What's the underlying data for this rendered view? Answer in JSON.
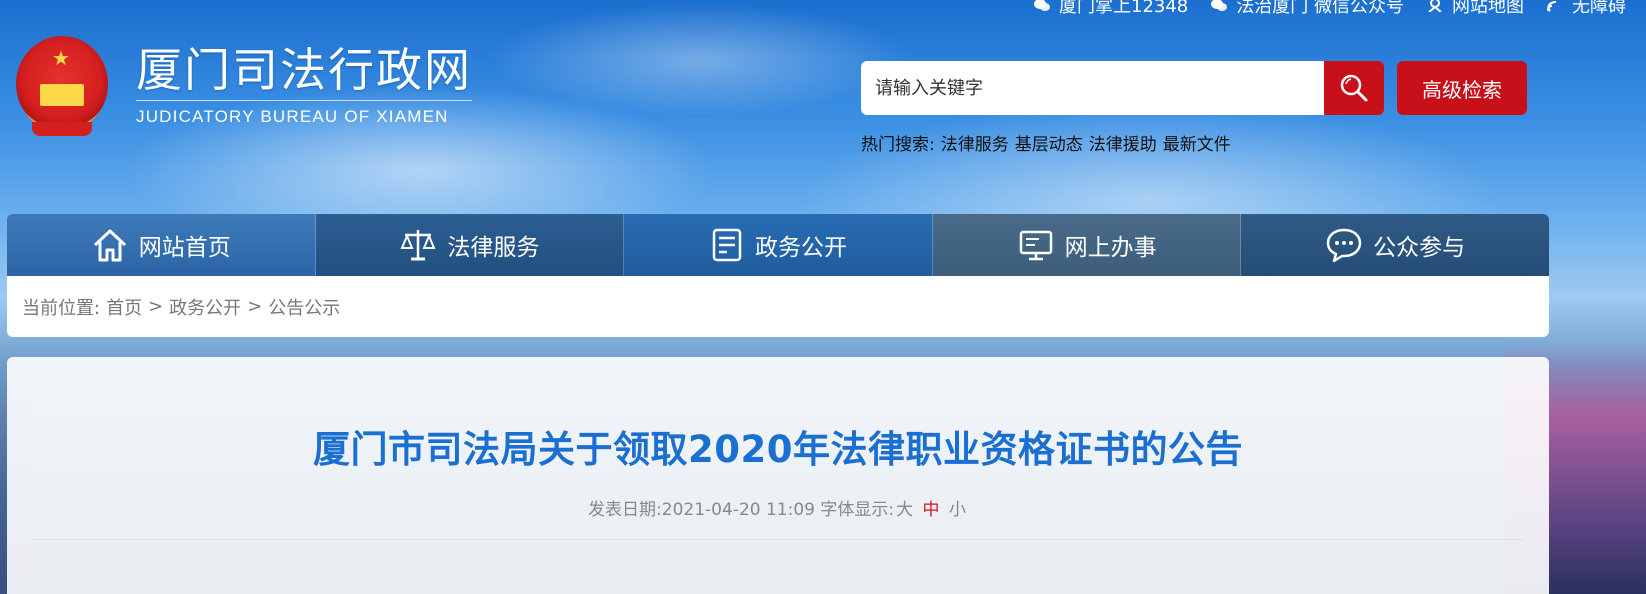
{
  "top_links": [
    {
      "icon": "wechat-icon",
      "label": "厦门掌上12348"
    },
    {
      "icon": "wechat-icon",
      "label": "法治厦门 微信公众号"
    },
    {
      "icon": "sitemap-icon",
      "label": "网站地图"
    },
    {
      "icon": "accessibility-icon",
      "label": "无障碍"
    }
  ],
  "logo": {
    "title_cn": "厦门司法行政网",
    "title_en": "JUDICATORY BUREAU OF XIAMEN"
  },
  "search": {
    "placeholder": "请输入关键字",
    "advanced_label": "高级检索"
  },
  "hot_search": {
    "label": "热门搜索:",
    "items": [
      "法律服务",
      "基层动态",
      "法律援助",
      "最新文件"
    ]
  },
  "nav": [
    {
      "icon": "home-icon",
      "label": "网站首页"
    },
    {
      "icon": "scale-icon",
      "label": "法律服务"
    },
    {
      "icon": "document-icon",
      "label": "政务公开"
    },
    {
      "icon": "monitor-icon",
      "label": "网上办事"
    },
    {
      "icon": "chat-icon",
      "label": "公众参与"
    }
  ],
  "breadcrumb": {
    "prefix": "当前位置:",
    "items": [
      "首页",
      "政务公开",
      "公告公示"
    ],
    "separator": ">"
  },
  "article": {
    "title": "厦门市司法局关于领取2020年法律职业资格证书的公告",
    "date_label": "发表日期:",
    "date": "2021-04-20 11:09",
    "font_label": "字体显示:",
    "font_sizes": [
      "大",
      "中",
      "小"
    ],
    "active_font_size": "中"
  },
  "colors": {
    "accent_red": "#c8101a",
    "title_blue": "#1a6fd0"
  }
}
